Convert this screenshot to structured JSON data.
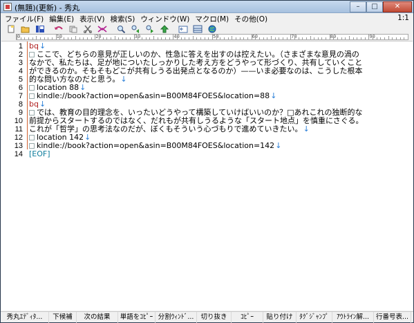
{
  "window": {
    "title": "(無題)(更新) - 秀丸",
    "min_label": "–",
    "max_label": "□",
    "close_label": "✕"
  },
  "menu": {
    "items": [
      "ファイル(F)",
      "編集(E)",
      "表示(V)",
      "検索(S)",
      "ウィンドウ(W)",
      "マクロ(M)",
      "その他(O)"
    ],
    "position": "1:1"
  },
  "toolbar": {
    "icons": [
      "new-file-icon",
      "open-folder-icon",
      "save-icon",
      "undo-icon",
      "copy-icon",
      "cut-icon",
      "paste-icon",
      "search-icon",
      "search-prev-icon",
      "search-next-icon",
      "jump-icon",
      "window-split-icon",
      "globe-icon"
    ]
  },
  "ruler": {
    "labels": [
      "0",
      "10",
      "20",
      "30",
      "40",
      "50",
      "60",
      "70",
      "80",
      "90"
    ]
  },
  "editor": {
    "line_numbers": [
      "1",
      "2",
      "3",
      "4",
      "5",
      "6",
      "7",
      "8",
      "9",
      "10",
      "11",
      "12",
      "13",
      "14"
    ],
    "lines": [
      {
        "text": "bq",
        "ret": "↓",
        "style": "red",
        "sq": false
      },
      {
        "text": "ここで、どちらの意見が正しいのか、性急に答えを出すのは控えたい。（さまざまな意見の渦の",
        "ret": "",
        "style": "",
        "sq": true
      },
      {
        "text": "なかで、私たちは、足が地についたしっかりした考え方をどうやって形づくり、共有していくこと",
        "ret": "",
        "style": "",
        "sq": false
      },
      {
        "text": "ができるのか。そもそもどこが共有しうる出発点となるのか）——いま必要なのは、こうした根本",
        "ret": "",
        "style": "",
        "sq": false
      },
      {
        "text": "的な問い方なのだと思う。",
        "ret": "↓",
        "style": "",
        "sq": false
      },
      {
        "text": "location 88",
        "ret": "↓",
        "style": "",
        "sq": true
      },
      {
        "text": "kindle://book?action=open&asin=B00M84FOES&location=88",
        "ret": "↓",
        "style": "",
        "sq": true
      },
      {
        "text": "bq",
        "ret": "↓",
        "style": "red",
        "sq": false
      },
      {
        "text": "では、教育の目的理念を、いったいどうやって構築していけばいいのか？□あれこれの独断的な",
        "ret": "",
        "style": "",
        "sq": true
      },
      {
        "text": "前提からスタートするのではなく、だれもが共有しうるような「スタート地点」を慎重にさぐる。",
        "ret": "",
        "style": "",
        "sq": false
      },
      {
        "text": "これが「哲学」の思考法なのだが、ぼくもそういう心づもりで進めていきたい。",
        "ret": "↓",
        "style": "",
        "sq": false
      },
      {
        "text": "location 142",
        "ret": "↓",
        "style": "",
        "sq": true
      },
      {
        "text": "kindle://book?action=open&asin=B00M84FOES&location=142",
        "ret": "↓",
        "style": "",
        "sq": true
      },
      {
        "text": "[EOF]",
        "ret": "",
        "style": "eof",
        "sq": false
      }
    ]
  },
  "statusbar": {
    "items": [
      "秀丸ｴﾃﾞｨﾀ...",
      "下候補",
      "次の結果",
      "単語をｺﾋﾟｰ",
      "分割ｳｨﾝﾄﾞ...",
      "切り抜き",
      "ｺﾋﾟｰ",
      "貼り付け",
      "ﾀｸﾞｼﾞｬﾝﾌﾟ",
      "ｱｳﾄﾗｲﾝ解...",
      "行番号表..."
    ]
  }
}
